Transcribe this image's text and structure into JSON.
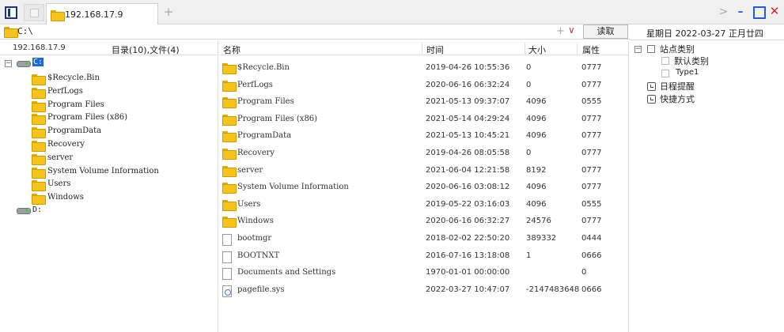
{
  "tabs": {
    "active_label": "192.168.17.9",
    "new_tab_symbol": "+"
  },
  "window_controls": {
    "chevron": ">",
    "minimize": "–",
    "close": "✕"
  },
  "address_bar": {
    "path": "C:\\",
    "add_symbol": "+",
    "dropdown_symbol": "∨",
    "read_label": "读取"
  },
  "left_panel": {
    "host": "192.168.17.9",
    "summary": "目录(10),文件(4)",
    "drive_c": "C:",
    "drive_d": "D:",
    "folders": [
      "$Recycle.Bin",
      "PerfLogs",
      "Program Files",
      "Program Files (x86)",
      "ProgramData",
      "Recovery",
      "server",
      "System Volume Information",
      "Users",
      "Windows"
    ]
  },
  "file_list": {
    "columns": {
      "name": "名称",
      "time": "时间",
      "size": "大小",
      "attr": "属性"
    },
    "rows": [
      {
        "type": "folder",
        "name": "$Recycle.Bin",
        "time": "2019-04-26 10:55:36",
        "size": "0",
        "attr": "0777"
      },
      {
        "type": "folder",
        "name": "PerfLogs",
        "time": "2020-06-16 06:32:24",
        "size": "0",
        "attr": "0777"
      },
      {
        "type": "folder",
        "name": "Program Files",
        "time": "2021-05-13 09:37:07",
        "size": "4096",
        "attr": "0555"
      },
      {
        "type": "folder",
        "name": "Program Files (x86)",
        "time": "2021-05-14 04:29:24",
        "size": "4096",
        "attr": "0777"
      },
      {
        "type": "folder",
        "name": "ProgramData",
        "time": "2021-05-13 10:45:21",
        "size": "4096",
        "attr": "0777"
      },
      {
        "type": "folder",
        "name": "Recovery",
        "time": "2019-04-26 08:05:58",
        "size": "0",
        "attr": "0777"
      },
      {
        "type": "folder",
        "name": "server",
        "time": "2021-06-04 12:21:58",
        "size": "8192",
        "attr": "0777"
      },
      {
        "type": "folder",
        "name": "System Volume Information",
        "time": "2020-06-16 03:08:12",
        "size": "4096",
        "attr": "0777"
      },
      {
        "type": "folder",
        "name": "Users",
        "time": "2019-05-22 03:16:03",
        "size": "4096",
        "attr": "0555"
      },
      {
        "type": "folder",
        "name": "Windows",
        "time": "2020-06-16 06:32:27",
        "size": "24576",
        "attr": "0777"
      },
      {
        "type": "file",
        "name": "bootmgr",
        "time": "2018-02-02 22:50:20",
        "size": "389332",
        "attr": "0444"
      },
      {
        "type": "file",
        "name": "BOOTNXT",
        "time": "2016-07-16 13:18:08",
        "size": "1",
        "attr": "0666"
      },
      {
        "type": "file",
        "name": "Documents and Settings",
        "time": "1970-01-01 00:00:00",
        "size": "",
        "attr": "0"
      },
      {
        "type": "sysfile",
        "name": "pagefile.sys",
        "time": "2022-03-27 10:47:07",
        "size": "-2147483648",
        "attr": "0666"
      }
    ]
  },
  "right_panel": {
    "date": "星期日 2022-03-27 正月廿四",
    "site_category": "站点类别",
    "default_category": "默认类别",
    "type1": "Type1",
    "schedule": "日程提醒",
    "shortcuts": "快捷方式",
    "collapse_symbol": "−"
  },
  "colors": {
    "accent": "#1c68d4",
    "folder": "#f5c41a",
    "close": "#d8262e",
    "window_control": "#2a5bd7"
  }
}
